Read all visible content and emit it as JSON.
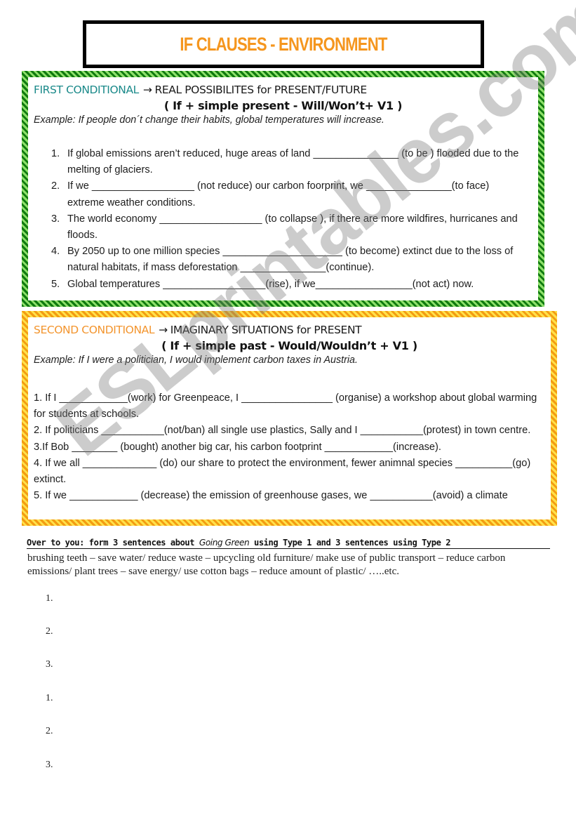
{
  "title": "IF CLAUSES - ENVIRONMENT",
  "first_conditional": {
    "name": "FIRST CONDITIONAL",
    "arrow": "→",
    "description": "REAL POSSIBILITES for PRESENT/FUTURE",
    "formula": "( If + simple present - Will/Won’t+ V1  )",
    "example": "Example:  If people don´t change their habits, global temperatures will increase.",
    "items": [
      {
        "num": "1.",
        "text": "If global emissions aren’t reduced, huge areas of land _______________ (to be ) flooded due to the melting of glaciers."
      },
      {
        "num": "2.",
        "text": "If we __________________ (not reduce) our carbon foorprint, we _______________(to face) extreme weather conditions."
      },
      {
        "num": "3.",
        "text": "The world economy __________________ (to collapse ), if there are more wildfires, hurricanes and floods."
      },
      {
        "num": "4.",
        "text": "By 2050 up to one million species _____________________ (to become) extinct due to the loss of natural habitats, if mass deforestation _______________(continue)."
      },
      {
        "num": "5.",
        "text": "Global temperatures __________________(rise), if we_________________(not act) now."
      }
    ]
  },
  "second_conditional": {
    "name": "SECOND CONDITIONAL",
    "arrow": "→",
    "description": "IMAGINARY SITUATIONS for PRESENT",
    "formula": "( If + simple past - Would/Wouldn’t + V1  )",
    "example": "Example:  If I were a politician, I would implement carbon taxes in Austria.",
    "items": [
      {
        "text": "1. If I ____________(work) for Greenpeace, I ________________ (organise) a workshop about global warming for students at schools."
      },
      {
        "text": "2. If politicians ___________(not/ban) all single use plastics, Sally and I ___________(protest) in town centre."
      },
      {
        "text": "3.If Bob ________ (bought) another big car, his carbon footprint ____________(increase)."
      },
      {
        "text": "4. If we all _____________ (do) our share to protect the environment, fewer animnal species __________(go) extinct."
      },
      {
        "text": "5. If we ____________ (decrease) the emission of greenhouse gases, we ___________(avoid) a climate"
      }
    ]
  },
  "over_to_you": {
    "title_part1": "Over to you: form 3 sentences about ",
    "title_emph": "Going Green",
    "title_part2": " using Type 1 and 3 sentences using Type 2",
    "prompts": "brushing teeth – save water/ reduce waste – upcycling old furniture/ make use of public transport – reduce carbon emissions/ plant trees – save energy/ use cotton bags – reduce amount of plastic/ …..etc.",
    "answers": [
      {
        "num": "1.",
        "value": ""
      },
      {
        "num": "2.",
        "value": ""
      },
      {
        "num": "3.",
        "value": ""
      },
      {
        "num": "1.",
        "value": ""
      },
      {
        "num": "2.",
        "value": ""
      },
      {
        "num": "3.",
        "value": ""
      }
    ]
  },
  "watermark": "ESLprintables.com",
  "colors": {
    "title": "#f5961e",
    "first_conditional_label": "#1b8a8a",
    "second_conditional_label": "#f3952e",
    "green_border": "#1f9a1f",
    "orange_border": "#f6b91c"
  }
}
